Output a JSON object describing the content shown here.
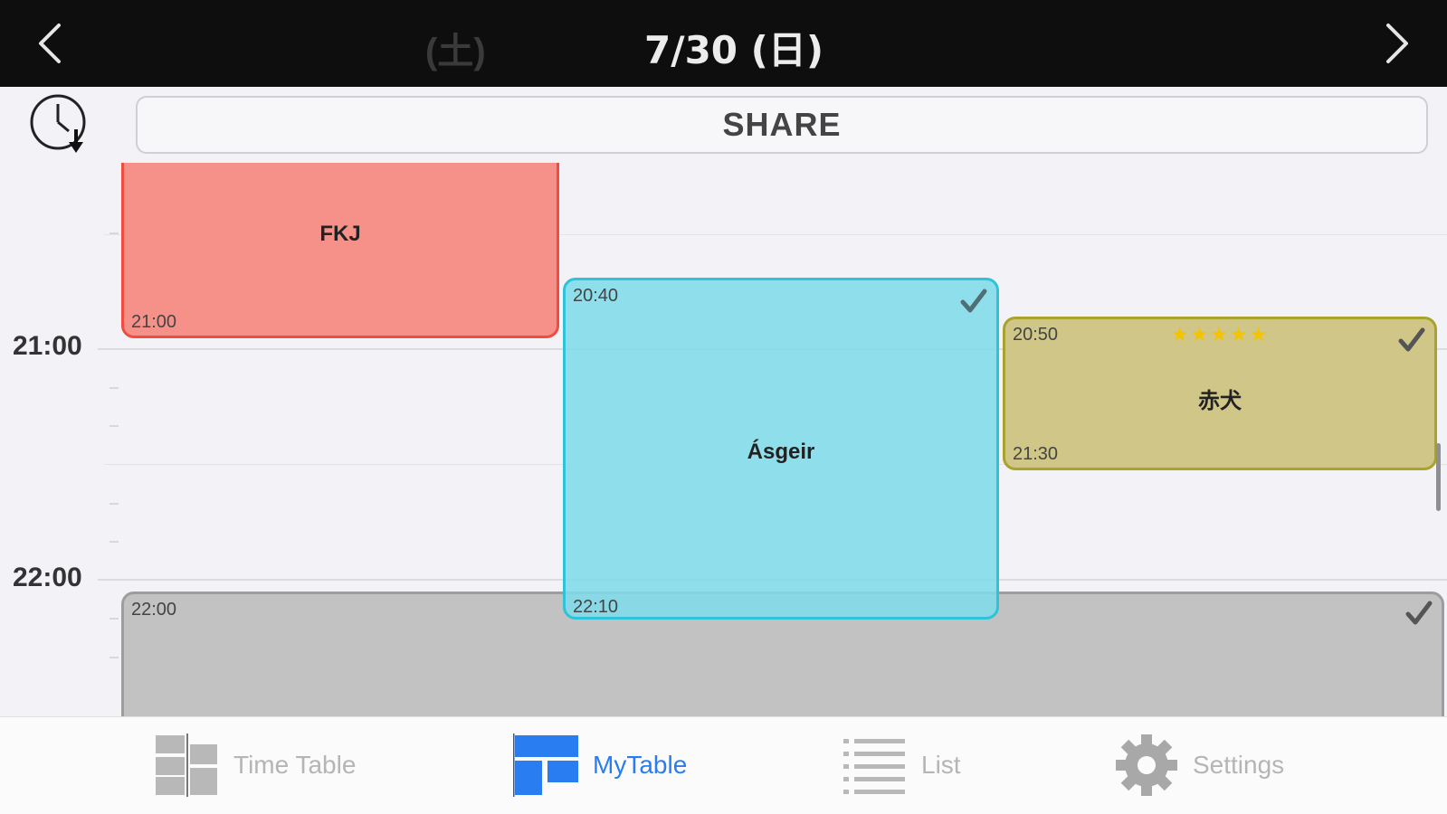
{
  "header": {
    "prev_day_fragment": "(土)",
    "date_title": "7/30 (日)",
    "prev_icon": "chevron-left-icon",
    "next_icon": "chevron-right-icon"
  },
  "toolbar": {
    "clock_icon": "clock-download-icon",
    "share_label": "SHARE"
  },
  "timeline": {
    "hours": [
      "21:00",
      "22:00"
    ]
  },
  "events": [
    {
      "name": "FKJ",
      "start": "",
      "end": "21:00",
      "color": "#f6918a",
      "checked": false,
      "rating": 0
    },
    {
      "name": "Ásgeir",
      "start": "20:40",
      "end": "22:10",
      "color": "#80dce9",
      "checked": true,
      "rating": 0
    },
    {
      "name": "赤犬",
      "start": "20:50",
      "end": "21:30",
      "color": "#cfc687",
      "checked": true,
      "rating": 5,
      "stars": "★★★★★"
    },
    {
      "name": "",
      "start": "22:00",
      "end": "",
      "color": "#c2c2c2",
      "checked": true,
      "rating": 0
    }
  ],
  "tabs": [
    {
      "label": "Time Table",
      "icon": "timetable-icon",
      "active": false
    },
    {
      "label": "MyTable",
      "icon": "mytable-icon",
      "active": true
    },
    {
      "label": "List",
      "icon": "list-icon",
      "active": false
    },
    {
      "label": "Settings",
      "icon": "gear-icon",
      "active": false
    }
  ],
  "colors": {
    "accent": "#2a7df0",
    "inactive_tab": "#b5b5b5",
    "header_bg": "#0e0e0e"
  }
}
